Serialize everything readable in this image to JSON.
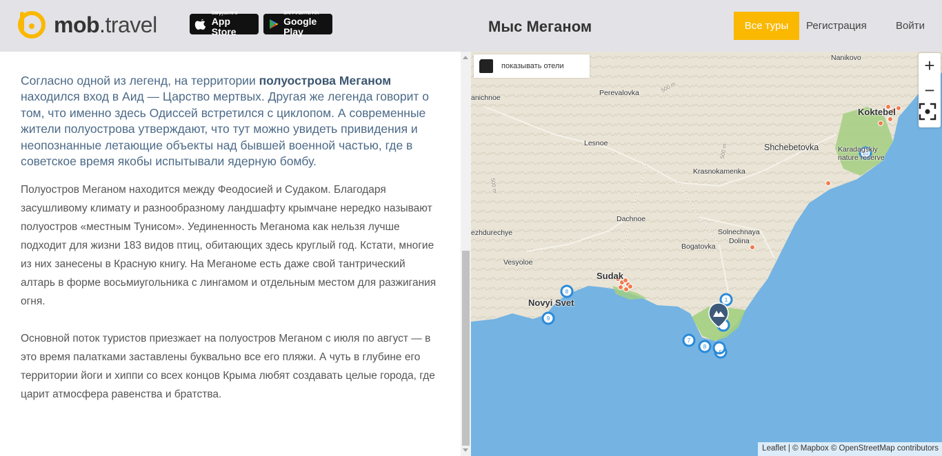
{
  "header": {
    "logo": {
      "bold": "mob",
      "dot": ".",
      "light": "travel"
    },
    "app_store": {
      "small": "Загрузите в",
      "big": "App Store"
    },
    "google_play": {
      "small": "ЗАГРУЗИТЕ НА",
      "big": "Google Play"
    },
    "title": "Мыс Меганом",
    "tours_button": "Все туры",
    "register_link": "Регистрация",
    "login_link": "Войти",
    "accent_color": "#fbb800"
  },
  "article": {
    "lead_before": "Согласно одной из легенд, на территории ",
    "lead_bold": "полуострова Меганом",
    "lead_after": " находился вход в Аид — Царство мертвых. Другая же легенда говорит о том, что именно здесь Одиссей встретился с циклопом. А современные жители полуострова утверждают, что тут можно увидеть привидения и неопознанные летающие объекты над бывшей военной частью, где в советское время якобы испытывали ядерную бомбу.",
    "para1": "Полуостров Меганом находится между Феодосией и Судаком. Благодаря засушливому климату и разнообразному ландшафту крымчане нередко называют полуостров «местным Тунисом». Уединенность Меганома как нельзя лучше подходит для жизни 183 видов птиц, обитающих здесь круглый год. Кстати, многие из них занесены в Красную книгу. На Меганоме есть даже свой тантрический алтарь в форме восьмиугольника с лингамом и отдельным местом для разжигания огня.",
    "para2": "Основной поток туристов приезжает на полуостров Меганом с июля по август — в это время палатками заставлены буквально все его пляжи. А чуть в глубине его территории йоги и хиппи со всех концов Крыма любят создавать целые города, где царит атмосфера равенства и братства."
  },
  "map": {
    "show_hotels_label": "показывать отели",
    "show_hotels_checked": true,
    "zoom_in": "+",
    "zoom_out": "−",
    "attribution": "Leaflet | © Mapbox © OpenStreetMap contributors",
    "labels": {
      "nanikovo": "Nanikovo",
      "perevalovka": "Perevalovka",
      "anichnoe": "anichnoe",
      "koktebel": "Koktebel",
      "lesnoe": "Lesnoe",
      "shchebetovka": "Shchebetovka",
      "kara_dag": "Karadagskiy",
      "reserve": "nature reserve",
      "krasnokamenka": "Krasnokamenka",
      "dachnoe": "Dachnoe",
      "mezhdurechye": "ezhdurechye",
      "solnechnaya": "Solnechnaya",
      "dolina": "Dolina",
      "bogatovka": "Bogatovka",
      "vesyoloe": "Vesyoloe",
      "sudak": "Sudak",
      "novyi_svet": "Novyi Svet",
      "elev1": "500 m",
      "elev2": "500 m",
      "elev3": "500 m"
    },
    "markers": [
      "1",
      "5",
      "7",
      "8",
      "8",
      "9",
      "10"
    ],
    "colors": {
      "sea": "#74b3e2",
      "land": "#e9e4d6",
      "green": "#a3cf80",
      "marker": "#2a8ad8",
      "hotel": "#f07a4e"
    }
  }
}
